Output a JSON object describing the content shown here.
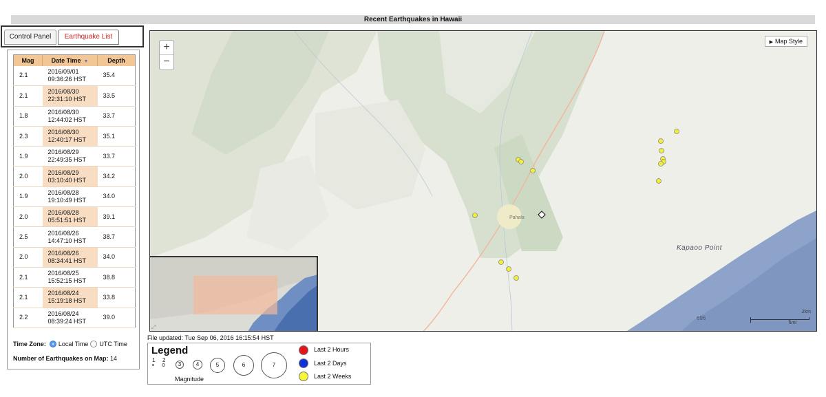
{
  "title": "Recent Earthquakes in Hawaii",
  "tabs": [
    {
      "label": "Control Panel"
    },
    {
      "label": "Earthquake List"
    }
  ],
  "table": {
    "headers": {
      "mag": "Mag",
      "datetime": "Date Time",
      "depth": "Depth"
    },
    "rows": [
      {
        "mag": "2.1",
        "date": "2016/09/01",
        "time": "09:36:26 HST",
        "depth": "35.4"
      },
      {
        "mag": "2.1",
        "date": "2016/08/30",
        "time": "22:31:10 HST",
        "depth": "33.5"
      },
      {
        "mag": "1.8",
        "date": "2016/08/30",
        "time": "12:44:02 HST",
        "depth": "33.7"
      },
      {
        "mag": "2.3",
        "date": "2016/08/30",
        "time": "12:40:17 HST",
        "depth": "35.1"
      },
      {
        "mag": "1.9",
        "date": "2016/08/29",
        "time": "22:49:35 HST",
        "depth": "33.7"
      },
      {
        "mag": "2.0",
        "date": "2016/08/29",
        "time": "03:10:40 HST",
        "depth": "34.2"
      },
      {
        "mag": "1.9",
        "date": "2016/08/28",
        "time": "19:10:49 HST",
        "depth": "34.0"
      },
      {
        "mag": "2.0",
        "date": "2016/08/28",
        "time": "05:51:51 HST",
        "depth": "39.1"
      },
      {
        "mag": "2.5",
        "date": "2016/08/26",
        "time": "14:47:10 HST",
        "depth": "38.7"
      },
      {
        "mag": "2.0",
        "date": "2016/08/26",
        "time": "08:34:41 HST",
        "depth": "34.0"
      },
      {
        "mag": "2.1",
        "date": "2016/08/25",
        "time": "15:52:15 HST",
        "depth": "38.8"
      },
      {
        "mag": "2.1",
        "date": "2016/08/24",
        "time": "15:19:18 HST",
        "depth": "33.8"
      },
      {
        "mag": "2.2",
        "date": "2016/08/24",
        "time": "08:39:24 HST",
        "depth": "39.0"
      }
    ]
  },
  "timezone": {
    "label": "Time Zone:",
    "local": "Local Time",
    "utc": "UTC Time",
    "selected": "local"
  },
  "count": {
    "label": "Number of Earthquakes on Map:",
    "value": "14"
  },
  "map": {
    "zoom_in": "+",
    "zoom_out": "−",
    "style_button": "Map Style",
    "town": "Pahala",
    "point": "Kapaoo Point",
    "route": "696",
    "scale_km": "2km",
    "scale_mi": "1mi",
    "marker_color": "#f2ee3a"
  },
  "file_updated": "File updated: Tue Sep 06, 2016 16:15:54 HST",
  "legend": {
    "title": "Legend",
    "magnitude_label": "Magnitude",
    "magnitudes": [
      "1",
      "2",
      "3",
      "4",
      "5",
      "6",
      "7"
    ],
    "ages": [
      {
        "label": "Last 2 Hours",
        "color": "#e3161b"
      },
      {
        "label": "Last 2 Days",
        "color": "#1232d6"
      },
      {
        "label": "Last 2 Weeks",
        "color": "#f5f53a"
      }
    ]
  }
}
